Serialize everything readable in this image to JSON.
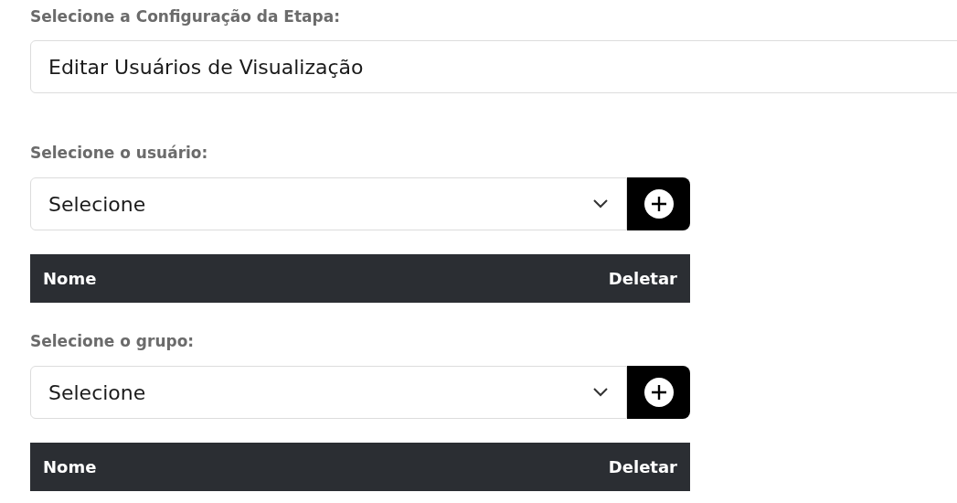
{
  "stage_config": {
    "label": "Selecione a Configuração da Etapa:",
    "value": "Editar Usuários de Visualização"
  },
  "sections": [
    {
      "label": "Selecione o usuário:",
      "select": {
        "value": "Selecione"
      },
      "table": {
        "columns": [
          "Nome",
          "Deletar"
        ]
      }
    },
    {
      "label": "Selecione o grupo:",
      "select": {
        "value": "Selecione"
      },
      "table": {
        "columns": [
          "Nome",
          "Deletar"
        ]
      }
    }
  ]
}
